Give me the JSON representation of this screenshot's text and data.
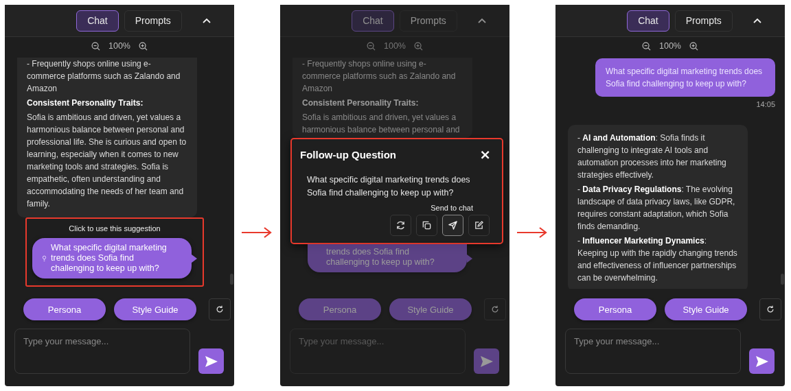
{
  "panels": [
    {
      "dimmed": false,
      "tabs": [
        {
          "label": "Chat",
          "selected": true
        },
        {
          "label": "Prompts",
          "selected": false
        }
      ],
      "zoom": "100%",
      "messages": [
        {
          "kind": "assistant",
          "cut": true,
          "paragraphs": [
            {
              "kind": "text",
              "text": "- Frequently shops online using e-commerce platforms such as Zalando and Amazon"
            },
            {
              "kind": "heading",
              "text": "Consistent Personality Traits:"
            },
            {
              "kind": "text",
              "text": "Sofia is ambitious and driven, yet values a harmonious balance between personal and professional life. She is curious and open to learning, especially when it comes to new marketing tools and strategies. Sofia is empathetic, often understanding and accommodating the needs of her team and family."
            }
          ]
        }
      ],
      "suggestion": {
        "highlighted": true,
        "hint": "Click to use this suggestion",
        "text": "What specific digital marketing trends does Sofia find challenging to keep up with?"
      },
      "actions": [
        "Persona",
        "Style Guide"
      ],
      "input": {
        "placeholder": "Type your message..."
      }
    },
    {
      "dimmed": true,
      "tabs": [
        {
          "label": "Chat",
          "selected": true
        },
        {
          "label": "Prompts",
          "selected": false
        }
      ],
      "zoom": "100%",
      "messages": [
        {
          "kind": "assistant",
          "cut": true,
          "paragraphs": [
            {
              "kind": "text",
              "text": "- Frequently shops online using e-commerce platforms such as Zalando and Amazon"
            },
            {
              "kind": "heading",
              "text": "Consistent Personality Traits:"
            },
            {
              "kind": "text",
              "text": "Sofia is ambitious and driven, yet values a harmonious balance between personal and"
            }
          ]
        }
      ],
      "dialog": {
        "highlighted": true,
        "title": "Follow-up Question",
        "close": "×",
        "question": "What specific digital marketing trends does Sofia find challenging to keep up with?",
        "tooltip": "Send to chat",
        "tools": [
          {
            "kind": "regenerate",
            "selected": false
          },
          {
            "kind": "copy",
            "selected": false
          },
          {
            "kind": "send",
            "selected": true
          },
          {
            "kind": "edit",
            "selected": false
          }
        ]
      },
      "suggestion": {
        "highlighted": false,
        "text": "trends does Sofia find challenging to keep up with?"
      },
      "actions": [
        "Persona",
        "Style Guide"
      ],
      "input": {
        "placeholder": "Type your message..."
      }
    },
    {
      "dimmed": false,
      "tabs": [
        {
          "label": "Chat",
          "selected": true
        },
        {
          "label": "Prompts",
          "selected": false
        }
      ],
      "zoom": "100%",
      "messages": [
        {
          "kind": "user",
          "text": "What specific digital marketing trends does Sofia find challenging to keep up with?",
          "time": "14:05"
        },
        {
          "kind": "assistant",
          "cut": false,
          "paragraphs": [
            {
              "kind": "text",
              "text": "- **AI and Automation**: Sofia finds it challenging to integrate AI tools and automation processes into her marketing strategies effectively."
            },
            {
              "kind": "text",
              "text": "- **Data Privacy Regulations**: The evolving landscape of data privacy laws, like GDPR, requires constant adaptation, which Sofia finds demanding."
            },
            {
              "kind": "text",
              "text": "- **Influencer Marketing Dynamics**: Keeping up with the rapidly changing trends and effectiveness of influencer partnerships can be overwhelming."
            }
          ]
        }
      ],
      "actions": [
        "Persona",
        "Style Guide"
      ],
      "input": {
        "placeholder": "Type your message..."
      }
    }
  ]
}
